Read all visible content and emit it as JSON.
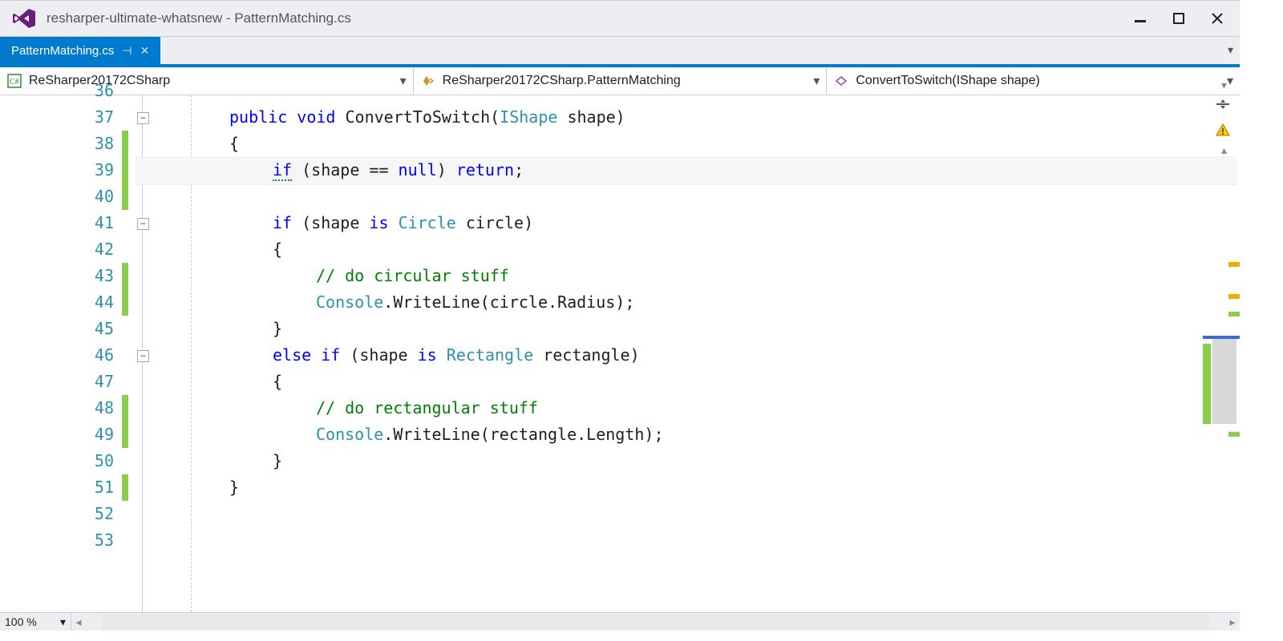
{
  "titlebar": {
    "title": "resharper-ultimate-whatsnew - PatternMatching.cs"
  },
  "tab": {
    "label": "PatternMatching.cs"
  },
  "nav": {
    "project": "ReSharper20172CSharp",
    "class": "ReSharper20172CSharp.PatternMatching",
    "method": "ConvertToSwitch(IShape shape)"
  },
  "editor": {
    "first_visible_line": 36,
    "lines": [
      {
        "n": 37,
        "fold": true,
        "change": false
      },
      {
        "n": 38,
        "fold": false,
        "change": false
      },
      {
        "n": 39,
        "fold": false,
        "change": false,
        "highlight": true,
        "bulb": true
      },
      {
        "n": 40,
        "fold": false,
        "change": false
      },
      {
        "n": 41,
        "fold": true,
        "change": false
      },
      {
        "n": 42,
        "fold": false,
        "change": false
      },
      {
        "n": 43,
        "fold": false,
        "change": true
      },
      {
        "n": 44,
        "fold": false,
        "change": true
      },
      {
        "n": 45,
        "fold": false,
        "change": false
      },
      {
        "n": 46,
        "fold": true,
        "change": false
      },
      {
        "n": 47,
        "fold": false,
        "change": false
      },
      {
        "n": 48,
        "fold": false,
        "change": true
      },
      {
        "n": 49,
        "fold": false,
        "change": true
      },
      {
        "n": 50,
        "fold": false,
        "change": false
      },
      {
        "n": 51,
        "fold": false,
        "change": true
      },
      {
        "n": 52,
        "fold": false,
        "change": false
      },
      {
        "n": 53,
        "fold": false,
        "change": false
      }
    ],
    "code": {
      "l37": {
        "kw1": "public",
        "kw2": "void",
        "name": " ConvertToSwitch(",
        "type": "IShape",
        "rest": " shape)"
      },
      "l38": "{",
      "l39": {
        "kw1": "if",
        "mid": " (shape == ",
        "kw2": "null",
        "mid2": ") ",
        "kw3": "return",
        "end": ";"
      },
      "l40": "",
      "l41": {
        "kw1": "if",
        "mid": " (shape ",
        "kw2": "is",
        "sp": " ",
        "type": "Circle",
        "rest": " circle)"
      },
      "l42": "{",
      "l43": "// do circular stuff",
      "l44": {
        "type": "Console",
        "rest": ".WriteLine(circle.Radius);"
      },
      "l45": "}",
      "l46": {
        "kw1": "else",
        "sp": " ",
        "kw2": "if",
        "mid": " (shape ",
        "kw3": "is",
        "sp2": " ",
        "type": "Rectangle",
        "rest": " rectangle)"
      },
      "l47": "{",
      "l48": "// do rectangular stuff",
      "l49": {
        "type": "Console",
        "rest": ".WriteLine(rectangle.Length);"
      },
      "l50": "}",
      "l51": "}",
      "l52": "",
      "l53": ""
    }
  },
  "zoom": {
    "level": "100 %"
  }
}
